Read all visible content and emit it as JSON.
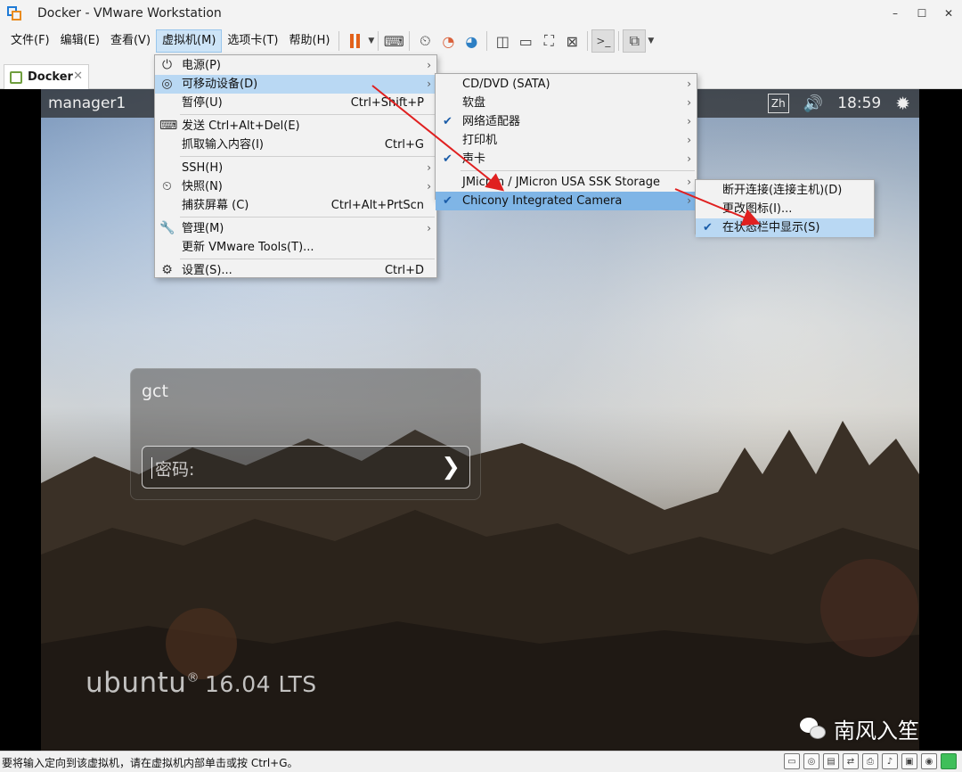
{
  "window": {
    "title": "Docker - VMware Workstation",
    "minimize": "–",
    "maximize": "☐",
    "close": "✕"
  },
  "menubar": {
    "items": [
      "文件(F)",
      "编辑(E)",
      "查看(V)",
      "虚拟机(M)",
      "选项卡(T)",
      "帮助(H)"
    ]
  },
  "tab": {
    "label": "Docker",
    "close": "✕"
  },
  "vm": {
    "hostname": "manager1",
    "keyboard_badge": "Zh",
    "volume_icon": "volume-icon",
    "clock": "18:59",
    "login": {
      "username": "gct",
      "password_placeholder": "密码:",
      "submit_glyph": "❯"
    },
    "os_logo": "ubuntu",
    "os_version": "16.04 LTS"
  },
  "vm_menu": {
    "items": [
      {
        "label": "电源(P)",
        "icon": "power-icon",
        "glyph": "⏻",
        "shortcut": "",
        "submenu": true
      },
      {
        "label": "可移动设备(D)",
        "icon": "removable-device-icon",
        "glyph": "◎",
        "shortcut": "",
        "submenu": true
      },
      {
        "label": "暂停(U)",
        "icon": "",
        "glyph": "",
        "shortcut": "Ctrl+Shift+P",
        "submenu": false
      },
      {
        "label": "发送 Ctrl+Alt+Del(E)",
        "icon": "send-keys-icon",
        "glyph": "⌨",
        "shortcut": "",
        "submenu": false
      },
      {
        "label": "抓取输入内容(I)",
        "icon": "",
        "glyph": "",
        "shortcut": "Ctrl+G",
        "submenu": false
      },
      {
        "label": "SSH(H)",
        "icon": "",
        "glyph": "",
        "shortcut": "",
        "submenu": true
      },
      {
        "label": "快照(N)",
        "icon": "snapshot-icon",
        "glyph": "⏲",
        "shortcut": "",
        "submenu": true
      },
      {
        "label": "捕获屏幕 (C)",
        "icon": "",
        "glyph": "",
        "shortcut": "Ctrl+Alt+PrtScn",
        "submenu": false
      },
      {
        "label": "管理(M)",
        "icon": "wrench-icon",
        "glyph": "🔧",
        "shortcut": "",
        "submenu": true
      },
      {
        "label": "更新 VMware Tools(T)...",
        "icon": "",
        "glyph": "",
        "shortcut": "",
        "submenu": false
      },
      {
        "label": "设置(S)...",
        "icon": "settings-icon",
        "glyph": "⚙",
        "shortcut": "Ctrl+D",
        "submenu": false
      }
    ]
  },
  "removable_menu": {
    "items": [
      {
        "label": "CD/DVD (SATA)",
        "checked": false
      },
      {
        "label": "软盘",
        "checked": false
      },
      {
        "label": "网络适配器",
        "checked": true
      },
      {
        "label": "打印机",
        "checked": false
      },
      {
        "label": "声卡",
        "checked": true
      },
      {
        "label": "JMicron / JMicron USA SSK Storage",
        "checked": false
      },
      {
        "label": "Chicony Integrated Camera",
        "checked": true
      }
    ]
  },
  "camera_menu": {
    "items": [
      {
        "label": "断开连接(连接主机)(D)",
        "checked": false
      },
      {
        "label": "更改图标(I)...",
        "checked": false
      },
      {
        "label": "在状态栏中显示(S)",
        "checked": true
      }
    ]
  },
  "watermark": {
    "text": "南风入笙"
  },
  "statusbar": {
    "message": "要将输入定向到该虚拟机，请在虚拟机内部单击或按 Ctrl+G。"
  },
  "colors": {
    "menu_highlight": "#b9d8f3",
    "menu_highlight_strong": "#7fb5e6",
    "arrow_red": "#e02020",
    "pause_orange": "#e2611a"
  }
}
